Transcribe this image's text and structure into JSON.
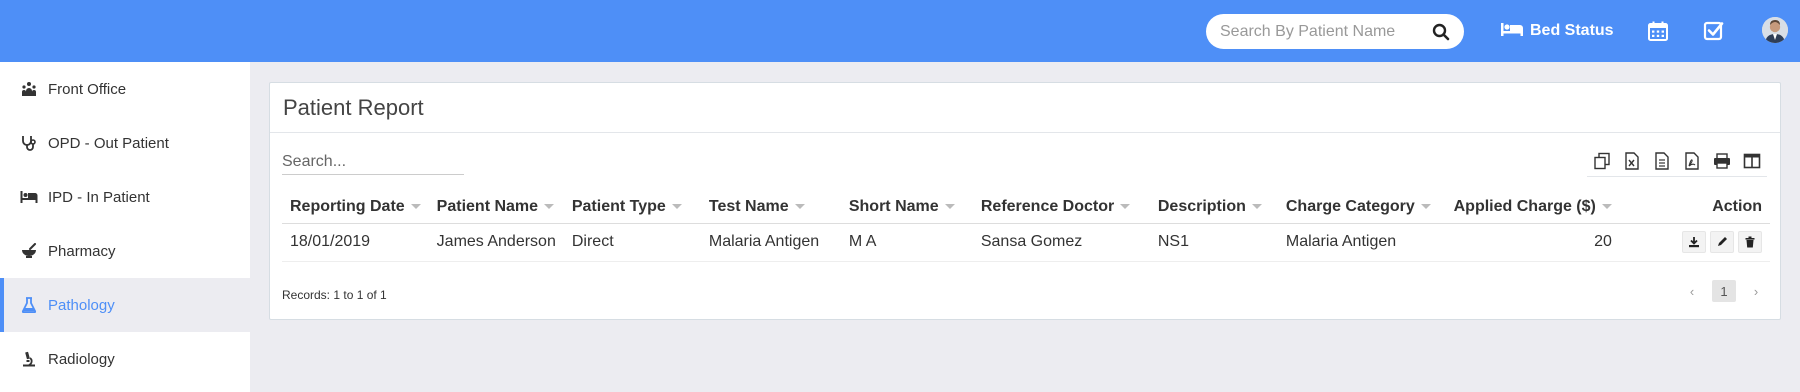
{
  "topbar": {
    "search_placeholder": "Search By Patient Name",
    "bed_status_label": "Bed Status"
  },
  "sidebar": {
    "items": [
      {
        "label": "Front Office",
        "icon": "front-office-icon"
      },
      {
        "label": "OPD - Out Patient",
        "icon": "stethoscope-icon"
      },
      {
        "label": "IPD - In Patient",
        "icon": "bed-icon"
      },
      {
        "label": "Pharmacy",
        "icon": "mortar-pestle-icon"
      },
      {
        "label": "Pathology",
        "icon": "flask-icon",
        "active": true
      },
      {
        "label": "Radiology",
        "icon": "microscope-icon"
      }
    ]
  },
  "panel": {
    "title": "Patient Report",
    "search_placeholder": "Search...",
    "columns": [
      "Reporting Date",
      "Patient Name",
      "Patient Type",
      "Test Name",
      "Short Name",
      "Reference Doctor",
      "Description",
      "Charge Category",
      "Applied Charge ($)",
      "Action"
    ],
    "rows": [
      [
        "18/01/2019",
        "James Anderson",
        "Direct",
        "Malaria Antigen",
        "M A",
        "Sansa Gomez",
        "NS1",
        "Malaria Antigen",
        "20"
      ]
    ],
    "records_text": "Records: 1 to 1 of 1",
    "page_prev": "‹",
    "page_current": "1",
    "page_next": "›"
  },
  "colors": {
    "accent": "#4e8ff7",
    "background": "#ececf1"
  }
}
